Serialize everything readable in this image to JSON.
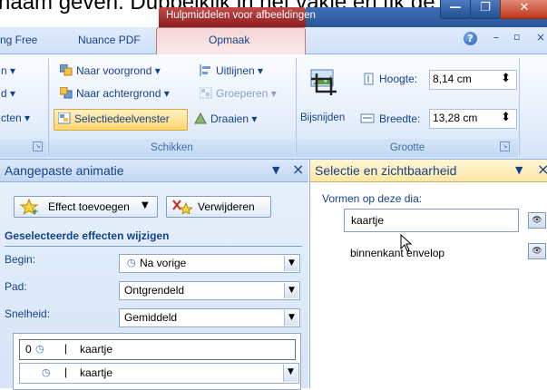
{
  "caption": "naam geven. Dubbelklik in het vakje en tik de",
  "window": {
    "context_title": "Hulpmiddelen voor afbeeldingen",
    "min_glyph": "—",
    "max_glyph": "❐",
    "close_glyph": "✕"
  },
  "tabs": {
    "first": "ng Free",
    "second": "Nuance PDF",
    "active": "Opmaak"
  },
  "ribbon_controls": {
    "help": "?",
    "minimize": "–",
    "restore": "▫",
    "close": "×"
  },
  "ribbon": {
    "left_partial": [
      "n ▾",
      "d ▾",
      "cten ▾"
    ],
    "arrange": {
      "bring_forward": "Naar voorgrond ▾",
      "send_backward": "Naar achtergrond ▾",
      "selection_pane": "Selectiedeelvenster",
      "align": "Uitlijnen ▾",
      "group": "Groeperen ▾",
      "rotate": "Draaien ▾",
      "footer": "Schikken"
    },
    "size": {
      "crop": "Bijsnijden",
      "height_label": "Hoogte:",
      "height_value": "8,14 cm",
      "width_label": "Breedte:",
      "width_value": "13,28 cm",
      "footer": "Grootte"
    },
    "launcher_glyph": "↘",
    "spin_glyph": "⬍"
  },
  "animation_pane": {
    "title": "Aangepaste animatie",
    "menu_glyph": "▼",
    "close_glyph": "×",
    "add_effect": "Effect toevoegen",
    "add_effect_arrow": "▼",
    "remove": "Verwijderen",
    "section_title": "Geselecteerde effecten wijzigen",
    "fields": [
      {
        "label": "Begin:",
        "value": "Na vorige"
      },
      {
        "label": "Pad:",
        "value": "Ontgrendeld"
      },
      {
        "label": "Snelheid:",
        "value": "Gemiddeld"
      }
    ],
    "list": [
      {
        "num": "0",
        "bar": "|",
        "name": "kaartje"
      },
      {
        "num": "",
        "bar": "|",
        "name": "kaartje"
      }
    ],
    "combo_arrow": "▼"
  },
  "selection_pane": {
    "title": "Selectie en zichtbaarheid",
    "menu_glyph": "▼",
    "close_glyph": "×",
    "shapes_label": "Vormen op deze dia:",
    "shapes": [
      {
        "name": "kaartje",
        "editing": true
      },
      {
        "name": "binnenkant envelop",
        "editing": false
      }
    ],
    "eye_glyph": "👁"
  },
  "colors": {
    "ribbon_text": "#15428b",
    "context_tab": "#c04848",
    "selected_button": "#ffd66e"
  }
}
